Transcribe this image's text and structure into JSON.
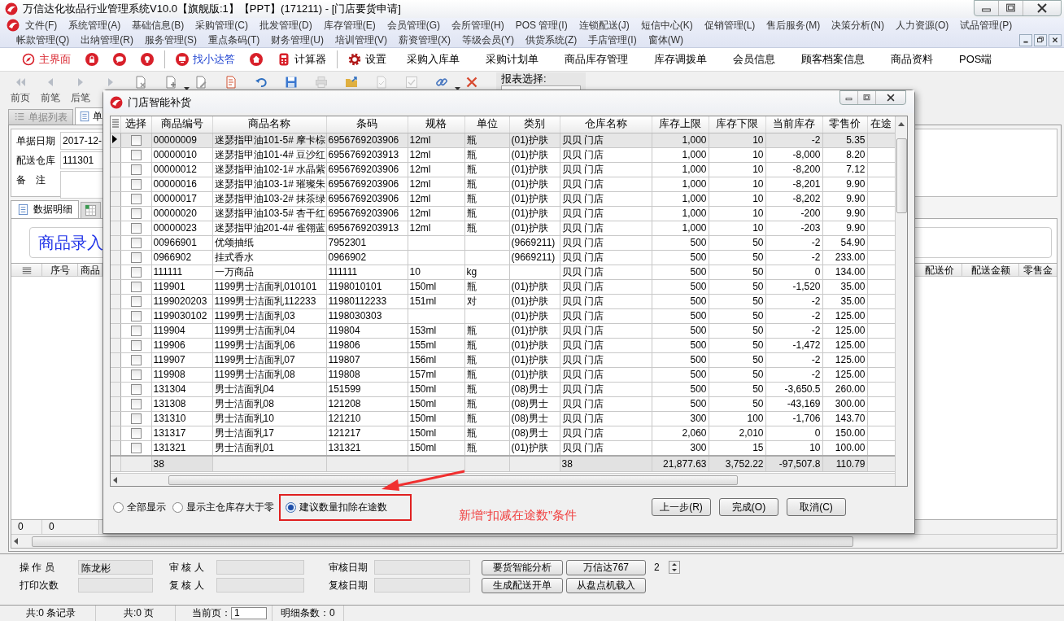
{
  "window": {
    "title": "万信达化妆品行业管理系统V10.0【旗舰版:1】【PPT】(171211) - [门店要货申请]"
  },
  "menu_rows": [
    [
      "文件(F)",
      "系统管理(A)",
      "基础信息(B)",
      "采购管理(C)",
      "批发管理(D)",
      "库存管理(E)",
      "会员管理(G)",
      "会所管理(H)",
      "POS 管理(I)",
      "连锁配送(J)",
      "短信中心(K)",
      "促销管理(L)",
      "售后服务(M)",
      "决策分析(N)",
      "人力资源(O)",
      "试品管理(P)"
    ],
    [
      "帐款管理(Q)",
      "出纳管理(R)",
      "服务管理(S)",
      "重点条码(T)",
      "财务管理(U)",
      "培训管理(V)",
      "薪资管理(X)",
      "等级会员(Y)",
      "供货系统(Z)",
      "手店管理(I)",
      "窗体(W)"
    ]
  ],
  "quick_bar": [
    {
      "kind": "compass",
      "label": "主界面"
    },
    {
      "kind": "lock"
    },
    {
      "kind": "chat"
    },
    {
      "kind": "bulb"
    },
    {
      "kind": "separator"
    },
    {
      "kind": "monitor",
      "label": "找小达答"
    },
    {
      "kind": "home"
    },
    {
      "kind": "calculator",
      "label": "计算器"
    },
    {
      "kind": "separator"
    },
    {
      "kind": "gear",
      "label": "设置"
    },
    {
      "kind": "text",
      "label": "采购入库单"
    },
    {
      "kind": "text",
      "label": "采购计划单"
    },
    {
      "kind": "text",
      "label": "商品库存管理"
    },
    {
      "kind": "text",
      "label": "库存调拨单"
    },
    {
      "kind": "text",
      "label": "会员信息"
    },
    {
      "kind": "text",
      "label": "顾客档案信息"
    },
    {
      "kind": "text",
      "label": "商品资料"
    },
    {
      "kind": "text",
      "label": "POS端"
    }
  ],
  "toolbar": [
    {
      "kind": "first",
      "label": "前页",
      "disabled": true,
      "dropdown": false
    },
    {
      "kind": "prev",
      "label": "前笔",
      "disabled": true,
      "dropdown": false
    },
    {
      "kind": "next",
      "label": "后笔",
      "disabled": true,
      "dropdown": false
    },
    {
      "kind": "last",
      "disabled": true,
      "dropdown": false
    },
    {
      "kind": "doc-delete",
      "disabled": false,
      "dropdown": false
    },
    {
      "kind": "doc-new",
      "disabled": false,
      "dropdown": true
    },
    {
      "kind": "doc-edit",
      "disabled": false,
      "dropdown": false
    },
    {
      "kind": "doc-list",
      "disabled": false,
      "dropdown": false
    },
    {
      "kind": "undo",
      "disabled": false,
      "dropdown": false
    },
    {
      "kind": "save",
      "disabled": false,
      "dropdown": false
    },
    {
      "kind": "print",
      "disabled": true,
      "dropdown": false
    },
    {
      "kind": "folder",
      "disabled": false,
      "dropdown": false
    },
    {
      "kind": "doc-tick",
      "disabled": true,
      "dropdown": false
    },
    {
      "kind": "checkbox",
      "disabled": true,
      "dropdown": false
    },
    {
      "kind": "link",
      "disabled": false,
      "dropdown": true
    },
    {
      "kind": "close",
      "disabled": false,
      "dropdown": false
    }
  ],
  "report_select": {
    "label": "报表选择:"
  },
  "doc_tabs": [
    {
      "label": "单据列表",
      "selected": false
    },
    {
      "label": "单",
      "selected": true
    }
  ],
  "header_fields": [
    {
      "label": "单据日期",
      "value": "2017-12-"
    },
    {
      "label": "配送仓库",
      "value": "111301"
    },
    {
      "label": "备　注"
    }
  ],
  "detail_tabs": [
    {
      "label": "数据明细",
      "selected": true
    },
    {
      "selected": false
    }
  ],
  "entry": {
    "label": "商品录入"
  },
  "detail_grid": {
    "columns_left": [
      "序号",
      "商品"
    ],
    "columns_right": [
      "配送价",
      "配送金额",
      "零售金"
    ],
    "footer": [
      "0",
      "0"
    ]
  },
  "bottom_form": {
    "fields": [
      {
        "label": "操 作 员",
        "value": "陈龙彬"
      },
      {
        "label": "审 核 人"
      },
      {
        "label": "审核日期"
      },
      {
        "label": "打印次数"
      },
      {
        "label": "复 核 人"
      },
      {
        "label": "复核日期"
      }
    ],
    "buttons": [
      "要货智能分析",
      "万信达767",
      "生成配送开单",
      "从盘点机载入"
    ],
    "spin": "2"
  },
  "status_bar": {
    "records": "共:0 条记录",
    "pages": "共:0 页",
    "page_label": "当前页：",
    "page": "1",
    "detail_count": "明细条数：0"
  },
  "dialog": {
    "title": "门店智能补货",
    "columns": [
      "选择",
      "商品编号",
      "商品名称",
      "条码",
      "规格",
      "单位",
      "类别",
      "仓库名称",
      "库存上限",
      "库存下限",
      "当前库存",
      "零售价",
      "在途"
    ],
    "rows": [
      {
        "selected": true,
        "checked": false,
        "code": "00000009",
        "name": "迷瑟指甲油101-5# 摩卡棕",
        "barcode": "6956769203906",
        "spec": "12ml",
        "unit": "瓶",
        "category": "(01)护肤",
        "warehouse": "贝贝 门店",
        "max": "1,000",
        "min": "10",
        "stock": "-2",
        "price": "5.35"
      },
      {
        "selected": false,
        "checked": false,
        "code": "00000010",
        "name": "迷瑟指甲油101-4# 豆沙红",
        "barcode": "6956769203913",
        "spec": "12ml",
        "unit": "瓶",
        "category": "(01)护肤",
        "warehouse": "贝贝 门店",
        "max": "1,000",
        "min": "10",
        "stock": "-8,000",
        "price": "8.20"
      },
      {
        "selected": false,
        "checked": false,
        "code": "00000012",
        "name": "迷瑟指甲油102-1# 水晶紫",
        "barcode": "6956769203906",
        "spec": "12ml",
        "unit": "瓶",
        "category": "(01)护肤",
        "warehouse": "贝贝 门店",
        "max": "1,000",
        "min": "10",
        "stock": "-8,200",
        "price": "7.12"
      },
      {
        "selected": false,
        "checked": false,
        "code": "00000016",
        "name": "迷瑟指甲油103-1# 璀璨朱",
        "barcode": "6956769203906",
        "spec": "12ml",
        "unit": "瓶",
        "category": "(01)护肤",
        "warehouse": "贝贝 门店",
        "max": "1,000",
        "min": "10",
        "stock": "-8,201",
        "price": "9.90"
      },
      {
        "selected": false,
        "checked": false,
        "code": "00000017",
        "name": "迷瑟指甲油103-2# 抹茶绿",
        "barcode": "6956769203906",
        "spec": "12ml",
        "unit": "瓶",
        "category": "(01)护肤",
        "warehouse": "贝贝 门店",
        "max": "1,000",
        "min": "10",
        "stock": "-8,202",
        "price": "9.90"
      },
      {
        "selected": false,
        "checked": false,
        "code": "00000020",
        "name": "迷瑟指甲油103-5# 杏干红",
        "barcode": "6956769203906",
        "spec": "12ml",
        "unit": "瓶",
        "category": "(01)护肤",
        "warehouse": "贝贝 门店",
        "max": "1,000",
        "min": "10",
        "stock": "-200",
        "price": "9.90"
      },
      {
        "selected": false,
        "checked": false,
        "code": "00000023",
        "name": "迷瑟指甲油201-4# 雀翎蓝",
        "barcode": "6956769203913",
        "spec": "12ml",
        "unit": "瓶",
        "category": "(01)护肤",
        "warehouse": "贝贝 门店",
        "max": "1,000",
        "min": "10",
        "stock": "-203",
        "price": "9.90"
      },
      {
        "selected": false,
        "checked": false,
        "code": "00966901",
        "name": "优颂抽纸",
        "barcode": "7952301",
        "category": "(9669211)",
        "warehouse": "贝贝 门店",
        "max": "500",
        "min": "50",
        "stock": "-2",
        "price": "54.90"
      },
      {
        "selected": false,
        "checked": false,
        "code": "0966902",
        "name": "挂式香水",
        "barcode": "0966902",
        "category": "(9669211)",
        "warehouse": "贝贝 门店",
        "max": "500",
        "min": "50",
        "stock": "-2",
        "price": "233.00"
      },
      {
        "selected": false,
        "checked": false,
        "code": "111111",
        "name": "一万商品",
        "barcode": "111111",
        "spec": "10",
        "unit": "kg",
        "warehouse": "贝贝 门店",
        "max": "500",
        "min": "50",
        "stock": "0",
        "price": "134.00"
      },
      {
        "selected": false,
        "checked": false,
        "code": "119901",
        "name": "1199男士洁面乳010101",
        "barcode": "1198010101",
        "spec": "150ml",
        "unit": "瓶",
        "category": "(01)护肤",
        "warehouse": "贝贝 门店",
        "max": "500",
        "min": "50",
        "stock": "-1,520",
        "price": "35.00"
      },
      {
        "selected": false,
        "checked": false,
        "code": "1199020203",
        "name": "1199男士洁面乳112233",
        "barcode": "11980112233",
        "spec": "151ml",
        "unit": "对",
        "category": "(01)护肤",
        "warehouse": "贝贝 门店",
        "max": "500",
        "min": "50",
        "stock": "-2",
        "price": "35.00"
      },
      {
        "selected": false,
        "checked": false,
        "code": "1199030102",
        "name": "1199男士洁面乳03",
        "barcode": "1198030303",
        "category": "(01)护肤",
        "warehouse": "贝贝 门店",
        "max": "500",
        "min": "50",
        "stock": "-2",
        "price": "125.00"
      },
      {
        "selected": false,
        "checked": false,
        "code": "119904",
        "name": "1199男士洁面乳04",
        "barcode": "119804",
        "spec": "153ml",
        "unit": "瓶",
        "category": "(01)护肤",
        "warehouse": "贝贝 门店",
        "max": "500",
        "min": "50",
        "stock": "-2",
        "price": "125.00"
      },
      {
        "selected": false,
        "checked": false,
        "code": "119906",
        "name": "1199男士洁面乳06",
        "barcode": "119806",
        "spec": "155ml",
        "unit": "瓶",
        "category": "(01)护肤",
        "warehouse": "贝贝 门店",
        "max": "500",
        "min": "50",
        "stock": "-1,472",
        "price": "125.00"
      },
      {
        "selected": false,
        "checked": false,
        "code": "119907",
        "name": "1199男士洁面乳07",
        "barcode": "119807",
        "spec": "156ml",
        "unit": "瓶",
        "category": "(01)护肤",
        "warehouse": "贝贝 门店",
        "max": "500",
        "min": "50",
        "stock": "-2",
        "price": "125.00"
      },
      {
        "selected": false,
        "checked": false,
        "code": "119908",
        "name": "1199男士洁面乳08",
        "barcode": "119808",
        "spec": "157ml",
        "unit": "瓶",
        "category": "(01)护肤",
        "warehouse": "贝贝 门店",
        "max": "500",
        "min": "50",
        "stock": "-2",
        "price": "125.00"
      },
      {
        "selected": false,
        "checked": false,
        "code": "131304",
        "name": "男士洁面乳04",
        "barcode": "151599",
        "spec": "150ml",
        "unit": "瓶",
        "category": "(08)男士",
        "warehouse": "贝贝 门店",
        "max": "500",
        "min": "50",
        "stock": "-3,650.5",
        "price": "260.00"
      },
      {
        "selected": false,
        "checked": false,
        "code": "131308",
        "name": "男士洁面乳08",
        "barcode": "121208",
        "spec": "150ml",
        "unit": "瓶",
        "category": "(08)男士",
        "warehouse": "贝贝 门店",
        "max": "500",
        "min": "50",
        "stock": "-43,169",
        "price": "300.00"
      },
      {
        "selected": false,
        "checked": false,
        "code": "131310",
        "name": "男士洁面乳10",
        "barcode": "121210",
        "spec": "150ml",
        "unit": "瓶",
        "category": "(08)男士",
        "warehouse": "贝贝 门店",
        "max": "300",
        "min": "100",
        "stock": "-1,706",
        "price": "143.70"
      },
      {
        "selected": false,
        "checked": false,
        "code": "131317",
        "name": "男士洁面乳17",
        "barcode": "121217",
        "spec": "150ml",
        "unit": "瓶",
        "category": "(08)男士",
        "warehouse": "贝贝 门店",
        "max": "2,060",
        "min": "2,010",
        "stock": "0",
        "price": "150.00"
      },
      {
        "selected": false,
        "checked": false,
        "code": "131321",
        "name": "男士洁面乳01",
        "barcode": "131321",
        "spec": "150ml",
        "unit": "瓶",
        "category": "(01)护肤",
        "warehouse": "贝贝 门店",
        "max": "300",
        "min": "15",
        "stock": "10",
        "price": "100.00"
      }
    ],
    "footer": {
      "code": "38",
      "warehouse": "38",
      "max": "21,877.63",
      "min": "3,752.22",
      "stock": "-97,507.8",
      "price": "110.79"
    },
    "options": [
      {
        "label": "全部显示",
        "selected": false,
        "highlighted": false
      },
      {
        "label": "显示主仓库存大于零",
        "selected": false,
        "highlighted": false
      },
      {
        "label": "建议数量扣除在途数",
        "selected": true,
        "highlighted": true
      }
    ],
    "annotation": {
      "text": "新增“扣减在途数”条件"
    },
    "buttons": [
      "上一步(R)",
      "完成(O)",
      "取消(C)"
    ]
  }
}
